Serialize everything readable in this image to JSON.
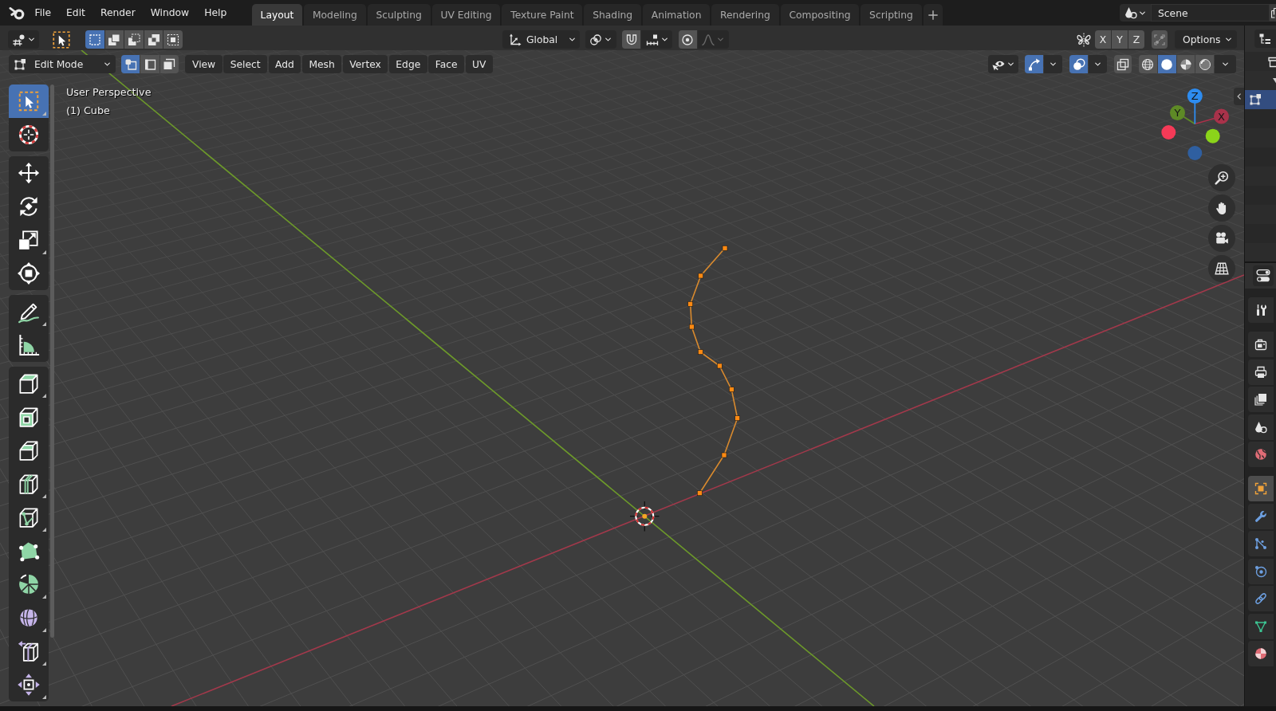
{
  "top_bar": {
    "menus": [
      "File",
      "Edit",
      "Render",
      "Window",
      "Help"
    ],
    "workspace_tabs": [
      {
        "label": "Layout",
        "selected": true
      },
      {
        "label": "Modeling",
        "selected": false
      },
      {
        "label": "Sculpting",
        "selected": false
      },
      {
        "label": "UV Editing",
        "selected": false
      },
      {
        "label": "Texture Paint",
        "selected": false
      },
      {
        "label": "Shading",
        "selected": false
      },
      {
        "label": "Animation",
        "selected": false
      },
      {
        "label": "Rendering",
        "selected": false
      },
      {
        "label": "Compositing",
        "selected": false
      },
      {
        "label": "Scripting",
        "selected": false
      }
    ],
    "scene": {
      "name": "Scene"
    }
  },
  "tool_header": {
    "select_modes": [
      {
        "kind": "set",
        "selected": true
      },
      {
        "kind": "extend",
        "selected": false
      },
      {
        "kind": "subtract",
        "selected": false
      },
      {
        "kind": "invert",
        "selected": false
      },
      {
        "kind": "intersect",
        "selected": false
      }
    ],
    "orientation": {
      "label": "Global"
    },
    "snap": {
      "on": false
    },
    "proportional_editing": {
      "on": false
    },
    "mirror_axes": [
      {
        "label": "X",
        "on": false
      },
      {
        "label": "Y",
        "on": false
      },
      {
        "label": "Z",
        "on": false
      }
    ],
    "auto_merge": {
      "on": false
    },
    "options": {
      "label": "Options"
    }
  },
  "view_header": {
    "mode": {
      "label": "Edit Mode"
    },
    "select_elements": [
      {
        "kind": "vertex",
        "selected": true
      },
      {
        "kind": "edge",
        "selected": false
      },
      {
        "kind": "face",
        "selected": false
      }
    ],
    "menus": [
      "View",
      "Select",
      "Add",
      "Mesh",
      "Vertex",
      "Edge",
      "Face",
      "UV"
    ],
    "gizmos": {
      "on": true
    },
    "overlays": {
      "on": true
    },
    "xray": {
      "on": false
    },
    "shading_modes": [
      {
        "kind": "wireframe",
        "selected": false
      },
      {
        "kind": "solid",
        "selected": true
      },
      {
        "kind": "material",
        "selected": false
      },
      {
        "kind": "rendered",
        "selected": false
      }
    ]
  },
  "toolbar": {
    "groups": [
      {
        "tools": [
          {
            "kind": "select",
            "selected": true,
            "submenu": true
          },
          {
            "kind": "cursor",
            "selected": false,
            "submenu": false
          }
        ]
      },
      {
        "tools": [
          {
            "kind": "move",
            "selected": false,
            "submenu": false
          },
          {
            "kind": "rotate",
            "selected": false,
            "submenu": false
          },
          {
            "kind": "scale",
            "selected": false,
            "submenu": true
          },
          {
            "kind": "transform",
            "selected": false,
            "submenu": false
          }
        ]
      },
      {
        "tools": [
          {
            "kind": "annotate",
            "selected": false,
            "submenu": true
          },
          {
            "kind": "measure",
            "selected": false,
            "submenu": false
          }
        ]
      },
      {
        "tools": [
          {
            "kind": "extrude",
            "selected": false,
            "submenu": true
          },
          {
            "kind": "inset",
            "selected": false,
            "submenu": false
          },
          {
            "kind": "bevel",
            "selected": false,
            "submenu": false
          },
          {
            "kind": "loopcut",
            "selected": false,
            "submenu": true
          },
          {
            "kind": "knife",
            "selected": false,
            "submenu": true
          },
          {
            "kind": "polybuild",
            "selected": false,
            "submenu": false
          },
          {
            "kind": "spin",
            "selected": false,
            "submenu": true
          },
          {
            "kind": "smooth",
            "selected": false,
            "submenu": true
          },
          {
            "kind": "slide",
            "selected": false,
            "submenu": true
          },
          {
            "kind": "shrink",
            "selected": false,
            "submenu": true
          }
        ]
      }
    ]
  },
  "viewport": {
    "view_name": "User Perspective",
    "object_name": "(1) Cube",
    "gizmo_axes": [
      {
        "label": "X",
        "color": "#a8324a"
      },
      {
        "label": "Y",
        "color": "#5e8a26"
      },
      {
        "label": "Z",
        "color": "#2d8cf0"
      }
    ],
    "negative_axes": [
      {
        "color": "#f53a57"
      },
      {
        "color": "#8bd41a"
      },
      {
        "color": "#2f5fa0"
      }
    ]
  },
  "outliner": {
    "rows": [
      {
        "kind": "collection",
        "selected": false,
        "children": [
          {
            "kind": "expander",
            "expanded": true,
            "selected": false,
            "children": [
              {
                "kind": "editmode",
                "selected": true
              }
            ]
          }
        ]
      }
    ]
  },
  "properties_tabs": {
    "groups": [
      {
        "tabs": [
          {
            "kind": "tool",
            "selected": false
          }
        ]
      },
      {
        "tabs": [
          {
            "kind": "render",
            "selected": false
          },
          {
            "kind": "output",
            "selected": false
          },
          {
            "kind": "viewlayer",
            "selected": false
          },
          {
            "kind": "scene",
            "selected": false
          },
          {
            "kind": "world",
            "selected": false
          }
        ]
      },
      {
        "tabs": [
          {
            "kind": "object",
            "selected": true
          },
          {
            "kind": "modifier",
            "selected": false
          },
          {
            "kind": "particles",
            "selected": false
          },
          {
            "kind": "physics",
            "selected": false
          },
          {
            "kind": "constraints",
            "selected": false
          },
          {
            "kind": "data",
            "selected": false
          },
          {
            "kind": "material",
            "selected": false
          }
        ]
      }
    ]
  }
}
